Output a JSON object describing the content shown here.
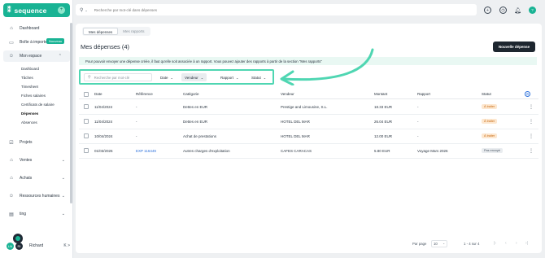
{
  "brand": {
    "name": "sequence",
    "mark": "⁑"
  },
  "sidebar": {
    "items": [
      {
        "label": "Dashboard",
        "icon": "home-icon",
        "glyph": "⌂"
      },
      {
        "label": "Boîte à importer",
        "icon": "inbox-icon",
        "glyph": "▭",
        "badge": "Nouveau"
      },
      {
        "label": "Mon espace",
        "icon": "person-icon",
        "glyph": "☺"
      }
    ],
    "sub_items": [
      "Dashboard",
      "Tâches",
      "Timesheet",
      "Fiches salaires",
      "Certificats de salaire",
      "Dépenses",
      "Absences"
    ],
    "bottom_items": [
      {
        "label": "Projets",
        "icon": "check-square-icon",
        "glyph": "☑"
      },
      {
        "label": "Ventes",
        "icon": "tag-icon",
        "glyph": "⌂"
      },
      {
        "label": "Achats",
        "icon": "cart-icon",
        "glyph": "⌂"
      },
      {
        "label": "Ressources humaines",
        "icon": "people-icon",
        "glyph": "☺"
      },
      {
        "label": "ting",
        "icon": "receipt-icon",
        "glyph": "▤"
      }
    ],
    "user": {
      "initials1": "LN",
      "initials2": "RI",
      "name": "Richard"
    }
  },
  "topbar": {
    "search_placeholder": "Recherche par mot-clé dans dépenses",
    "avatar": "?"
  },
  "main": {
    "tabs": [
      "Mes dépenses",
      "Mes rapports"
    ],
    "title": "Mes dépenses (4)",
    "new_button": "Nouvelle dépense",
    "info_text": "Pour pouvoir envoyer une dépense créée, il faut qu'elle soit associée à un rapport. Vous pouvez ajouter des rapports à partir de la section \"Mes rapports\"",
    "filters": {
      "search_placeholder": "Recherche par mot-clé",
      "date": "Date",
      "vendor": "Vendeur",
      "report": "Rapport",
      "status": "Statut"
    },
    "columns": [
      "Date",
      "Référence",
      "Catégorie",
      "Vendeur",
      "Montant",
      "Rapport",
      "Statut"
    ],
    "rows": [
      {
        "date": "11/04/2024",
        "ref": "-",
        "category": "Dettes en EUR",
        "vendor": "Prestige and Limousine, S.L.",
        "amount": "18.33 EUR",
        "report": "-",
        "status": "À traiter"
      },
      {
        "date": "11/04/2024",
        "ref": "-",
        "category": "Dettes en EUR",
        "vendor": "HOTEL DEL MAR",
        "amount": "26.04 EUR",
        "report": "-",
        "status": "À traiter"
      },
      {
        "date": "10/04/2024",
        "ref": "-",
        "category": "Achat de prestations",
        "vendor": "HOTEL DEL MAR",
        "amount": "12.00 EUR",
        "report": "-",
        "status": "À traiter"
      },
      {
        "date": "01/03/2026",
        "ref": "EXP 116449",
        "category": "Autres charges d'exploitation",
        "vendor": "CAFES CARACAS",
        "amount": "5.80 EUR",
        "report": "Voyage Mars 2026",
        "status": "Pas envoyé"
      }
    ],
    "pager": {
      "label": "Par page",
      "per_page": "10",
      "range": "1 - 4 sur 4"
    }
  },
  "colors": {
    "brand": "#19b394",
    "highlight": "#4fd6b2",
    "dark_button": "#1d262f",
    "todo_badge": "#fde7cf"
  }
}
